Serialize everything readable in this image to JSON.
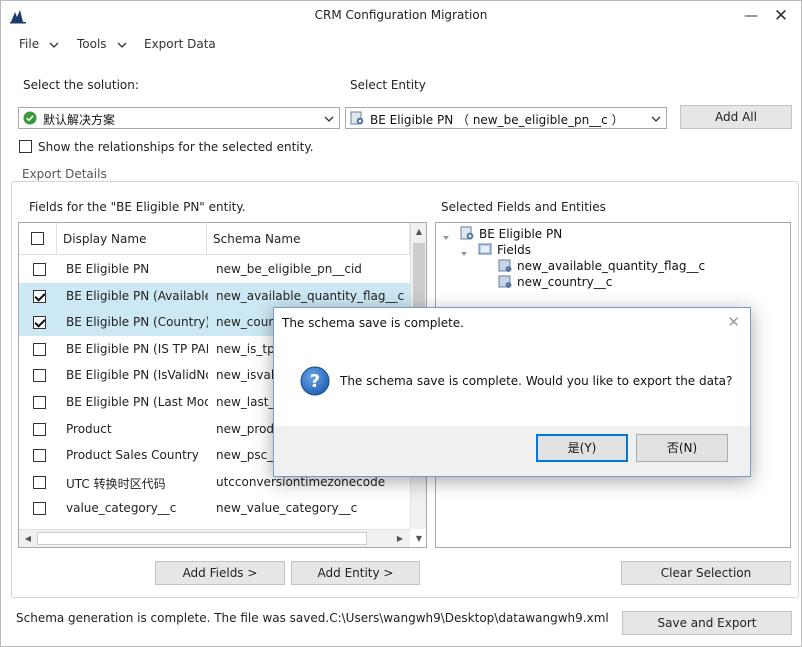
{
  "window": {
    "title": "CRM Configuration Migration"
  },
  "menu": {
    "file": "File",
    "tools": "Tools",
    "export_data": "Export Data"
  },
  "solution": {
    "label": "Select the solution:",
    "value": "默认解决方案"
  },
  "entity": {
    "label": "Select Entity",
    "value": "BE Eligible PN （ new_be_eligible_pn__c ）"
  },
  "buttons": {
    "add_all": "Add All",
    "add_fields": "Add Fields >",
    "add_entity": "Add Entity >",
    "clear_selection": "Clear Selection",
    "save_and_export": "Save and Export"
  },
  "show_relationships": {
    "label": "Show the relationships for the selected entity.",
    "checked": false
  },
  "export_details": {
    "legend": "Export Details",
    "fields_label": "Fields  for the \"BE Eligible PN\" entity.",
    "selected_label": "Selected Fields and Entities"
  },
  "grid": {
    "columns": [
      "Display Name",
      "Schema Name"
    ],
    "rows": [
      {
        "display": "BE Eligible PN",
        "schema": "new_be_eligible_pn__cid",
        "checked": false
      },
      {
        "display": "BE Eligible PN (Available C",
        "schema": "new_available_quantity_flag__c",
        "checked": true
      },
      {
        "display": "BE Eligible PN (Country)",
        "schema": "new_count",
        "checked": true
      },
      {
        "display": "BE Eligible PN (IS TP PART)",
        "schema": "new_is_tp_",
        "checked": false
      },
      {
        "display": "BE Eligible PN (IsValidNow",
        "schema": "new_isvalic",
        "checked": false
      },
      {
        "display": "BE Eligible PN (Last Modifi",
        "schema": "new_last_m",
        "checked": false
      },
      {
        "display": "Product",
        "schema": "new_produ",
        "checked": false
      },
      {
        "display": "Product Sales Country",
        "schema": "new_psc__c",
        "checked": false
      },
      {
        "display": "UTC 转换时区代码",
        "schema": "utcconversiontimezonecode",
        "checked": false
      },
      {
        "display": "value_category__c",
        "schema": "new_value_category__c",
        "checked": false
      }
    ]
  },
  "tree": {
    "entity": "BE Eligible PN",
    "fields_folder": "Fields",
    "fields": [
      "new_available_quantity_flag__c",
      "new_country__c"
    ]
  },
  "dialog": {
    "title": "The schema save is complete.",
    "message": "The schema save is complete. Would you like to export the data?",
    "yes": "是(Y)",
    "no": "否(N)"
  },
  "status": "Schema generation is complete. The file was saved.C:\\Users\\wangwh9\\Desktop\\datawangwh9.xml",
  "colors": {
    "accent": "#0078d7",
    "selected_row": "#cce8f4",
    "question_icon": "#1e5fb4"
  }
}
